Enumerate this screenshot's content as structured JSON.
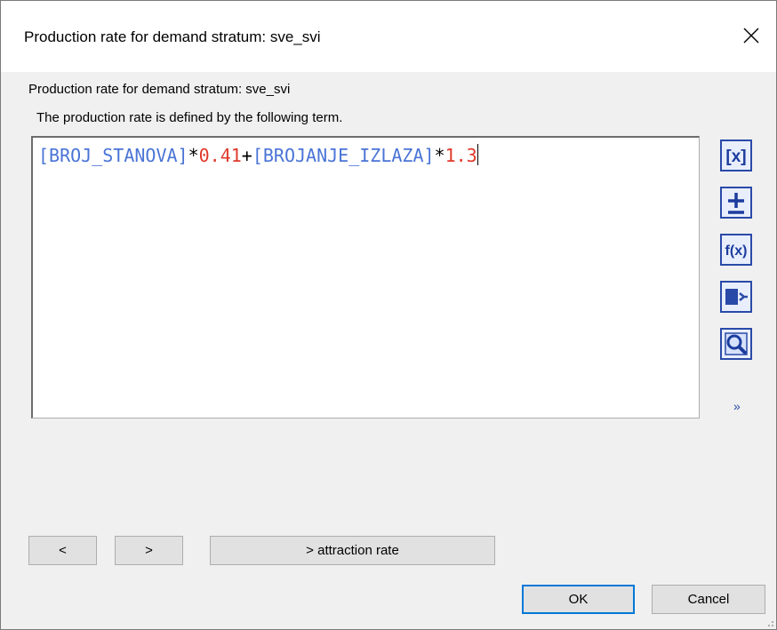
{
  "window": {
    "title": "Production rate for demand stratum: sve_svi"
  },
  "labels": {
    "heading": "Production rate for demand stratum: sve_svi",
    "description": "The production rate is defined by the following term."
  },
  "term": {
    "tokens": [
      {
        "type": "var",
        "text": "[BROJ_STANOVA]"
      },
      {
        "type": "op",
        "text": "*"
      },
      {
        "type": "num",
        "text": "0.41"
      },
      {
        "type": "op",
        "text": "+"
      },
      {
        "type": "var",
        "text": "[BROJANJE_IZLAZA]"
      },
      {
        "type": "op",
        "text": "*"
      },
      {
        "type": "num",
        "text": "1.3"
      }
    ]
  },
  "tools": [
    {
      "name": "insert-attribute-icon",
      "glyph": "[x]"
    },
    {
      "name": "insert-operator-icon",
      "glyph": "±"
    },
    {
      "name": "insert-function-icon",
      "glyph": "f(x)"
    },
    {
      "name": "insert-reference-icon",
      "glyph": "▮>"
    },
    {
      "name": "preview-icon",
      "glyph": "🔍"
    }
  ],
  "more_label": "»",
  "buttons": {
    "prev": "<",
    "next": ">",
    "attraction": "> attraction rate",
    "ok": "OK",
    "cancel": "Cancel"
  },
  "colors": {
    "variable": "#4a74d6",
    "operator": "#000000",
    "number": "#e0392b",
    "default_button_border": "#0078d7"
  }
}
